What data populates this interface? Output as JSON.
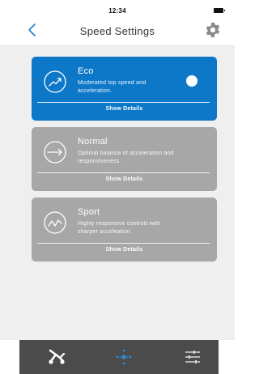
{
  "status": {
    "time": "12:34"
  },
  "header": {
    "title": "Speed Settings"
  },
  "icons": {
    "back": "chevron-left-icon",
    "settings": "gear-icon"
  },
  "colors": {
    "accent": "#0e78c8",
    "inactive": "#a7a7a7",
    "tabbar": "#4b4b4b",
    "background": "#efefef"
  },
  "modes": [
    {
      "name": "Eco",
      "description": "Moderated top speed and acceleration.",
      "details_label": "Show Details",
      "active": true,
      "icon": "eco-speed-icon"
    },
    {
      "name": "Normal",
      "description": "Optimal balance of acceleration and responsiveness.",
      "details_label": "Show Details",
      "active": false,
      "icon": "normal-speed-icon"
    },
    {
      "name": "Sport",
      "description": "Highly responsive controls with sharper acceleation.",
      "details_label": "Show Details",
      "active": false,
      "icon": "sport-speed-icon"
    }
  ],
  "tabbar": {
    "items": [
      {
        "icon": "scooter-icon",
        "active": false
      },
      {
        "icon": "move-icon",
        "active": true
      },
      {
        "icon": "sliders-icon",
        "active": false
      }
    ]
  }
}
